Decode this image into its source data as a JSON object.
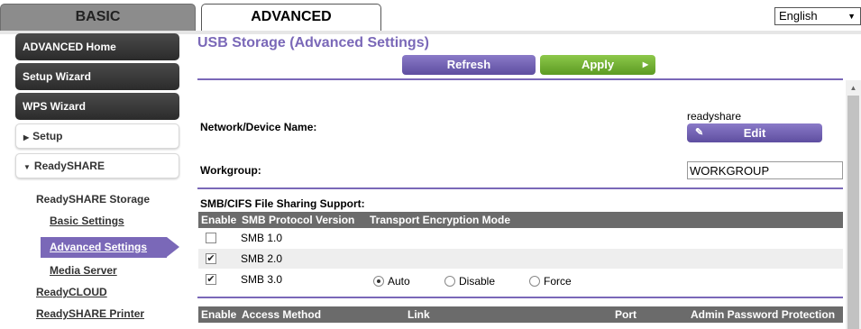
{
  "tabs": {
    "basic": "BASIC",
    "advanced": "ADVANCED"
  },
  "language": {
    "selected": "English",
    "arrow": "▼"
  },
  "sidebar": {
    "advanced_home": "ADVANCED Home",
    "setup_wizard": "Setup Wizard",
    "wps_wizard": "WPS Wizard",
    "setup": "Setup",
    "readyshare": "ReadySHARE",
    "readyshare_storage": "ReadySHARE Storage",
    "basic_settings": "Basic Settings",
    "advanced_settings": "Advanced Settings",
    "media_server": "Media Server",
    "readycloud": "ReadyCLOUD",
    "readyshare_printer": "ReadySHARE Printer"
  },
  "main": {
    "title": "USB Storage (Advanced Settings)",
    "refresh_label": "Refresh",
    "apply_label": "Apply",
    "device_name_label": "Network/Device Name:",
    "device_name_value": "readyshare",
    "edit_label": "Edit",
    "workgroup_label": "Workgroup:",
    "workgroup_value": "WORKGROUP",
    "smb_section_label": "SMB/CIFS File Sharing Support:",
    "smb_table": {
      "headers": [
        "Enable",
        "SMB Protocol Version",
        "Transport Encryption Mode"
      ],
      "rows": [
        {
          "version": "SMB 1.0",
          "enabled": false
        },
        {
          "version": "SMB 2.0",
          "enabled": true
        },
        {
          "version": "SMB 3.0",
          "enabled": true
        }
      ],
      "encryption_options": [
        "Auto",
        "Disable",
        "Force"
      ],
      "encryption_selected": "Auto"
    },
    "access_table": {
      "headers": [
        "Enable",
        "Access Method",
        "Link",
        "Port",
        "Admin Password Protection"
      ]
    }
  },
  "colors": {
    "accent": "#7a68b8",
    "apply_green": "#6fb032",
    "sidebar_dark": "#333333",
    "table_header": "#6b6b6b"
  }
}
